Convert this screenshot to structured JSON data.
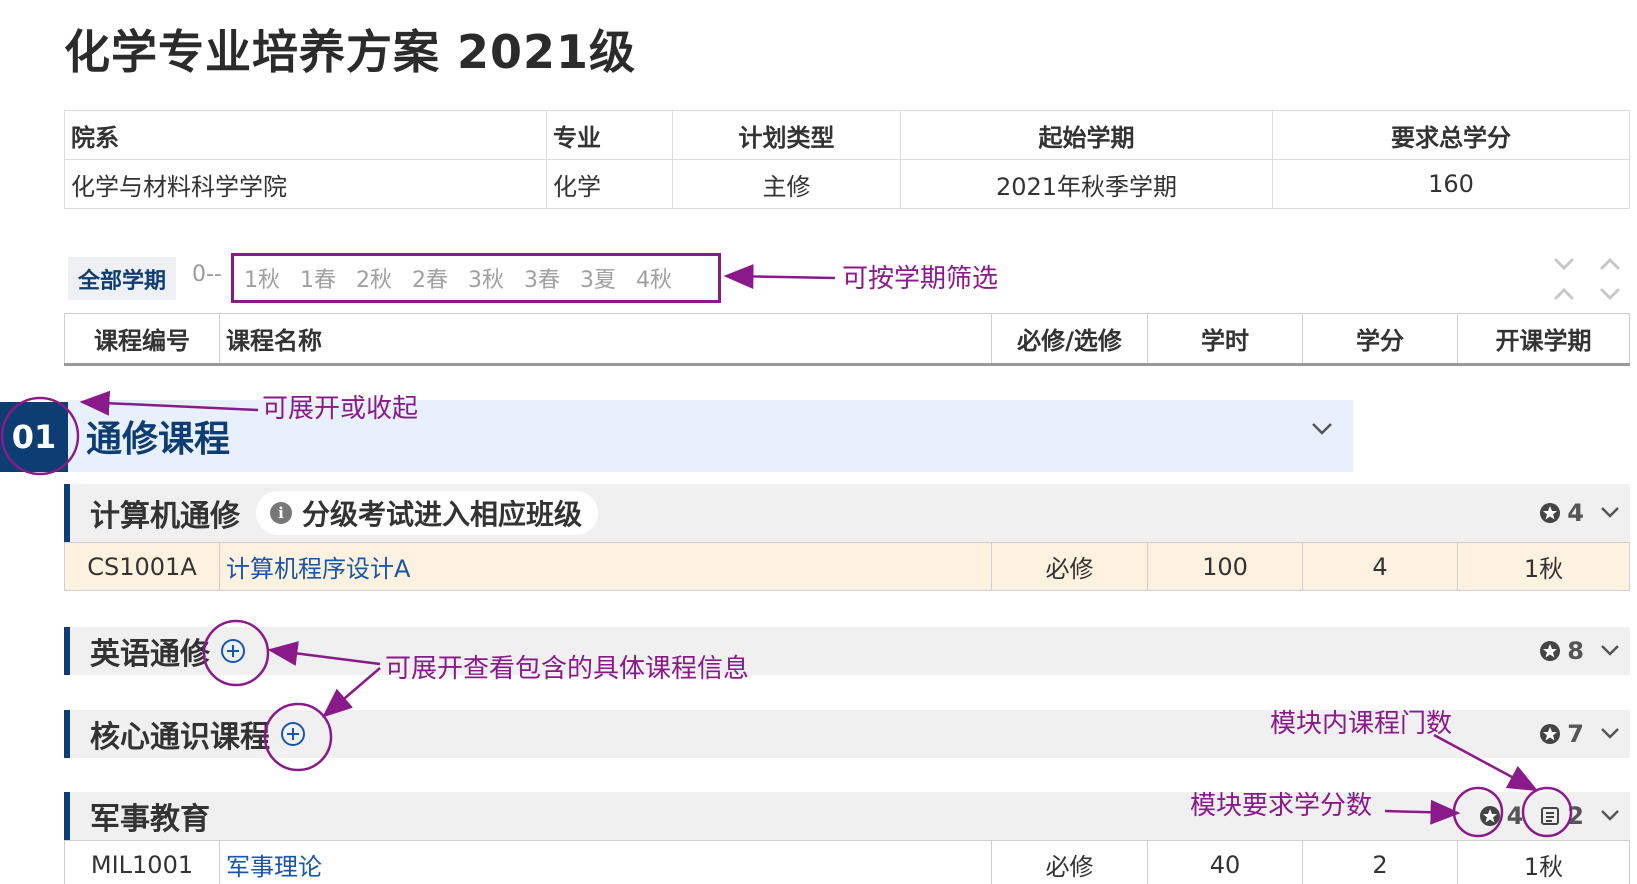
{
  "page": {
    "title": "化学专业培养方案 2021级"
  },
  "info": {
    "headers": [
      "院系",
      "专业",
      "计划类型",
      "起始学期",
      "要求总学分"
    ],
    "values": [
      "化学与材料科学学院",
      "化学",
      "主修",
      "2021年秋季学期",
      "160"
    ]
  },
  "filter": {
    "all_label": "全部学期",
    "zero_label": "0--",
    "semesters": [
      "1秋",
      "1春",
      "2秋",
      "2春",
      "3秋",
      "3春",
      "3夏",
      "4秋"
    ]
  },
  "columns": [
    "课程编号",
    "课程名称",
    "必修/选修",
    "学时",
    "学分",
    "开课学期"
  ],
  "section": {
    "number": "01",
    "title": "通修课程"
  },
  "modules": [
    {
      "title": "计算机通修",
      "note": "分级考试进入相应班级",
      "credits": "4"
    },
    {
      "title": "英语通修",
      "credits": "8"
    },
    {
      "title": "核心通识课程",
      "credits": "7"
    },
    {
      "title": "军事教育",
      "credits": "4",
      "course_count": "2"
    }
  ],
  "courses": {
    "cs": {
      "code": "CS1001A",
      "name": "计算机程序设计A",
      "type": "必修",
      "hours": "100",
      "credits": "4",
      "term": "1秋"
    },
    "mil": {
      "code": "MIL1001",
      "name": "军事理论",
      "type": "必修",
      "hours": "40",
      "credits": "2",
      "term": "1秋"
    }
  },
  "annotations": {
    "filter": "可按学期筛选",
    "expand": "可展开或收起",
    "expand_detail": "可展开查看包含的具体课程信息",
    "course_count": "模块内课程门数",
    "credit_req": "模块要求学分数"
  },
  "colors": {
    "primary": "#0d3d72",
    "annotation": "#8a1a8a",
    "link": "#1a56a8",
    "highlight_row": "#fdf1e0"
  }
}
